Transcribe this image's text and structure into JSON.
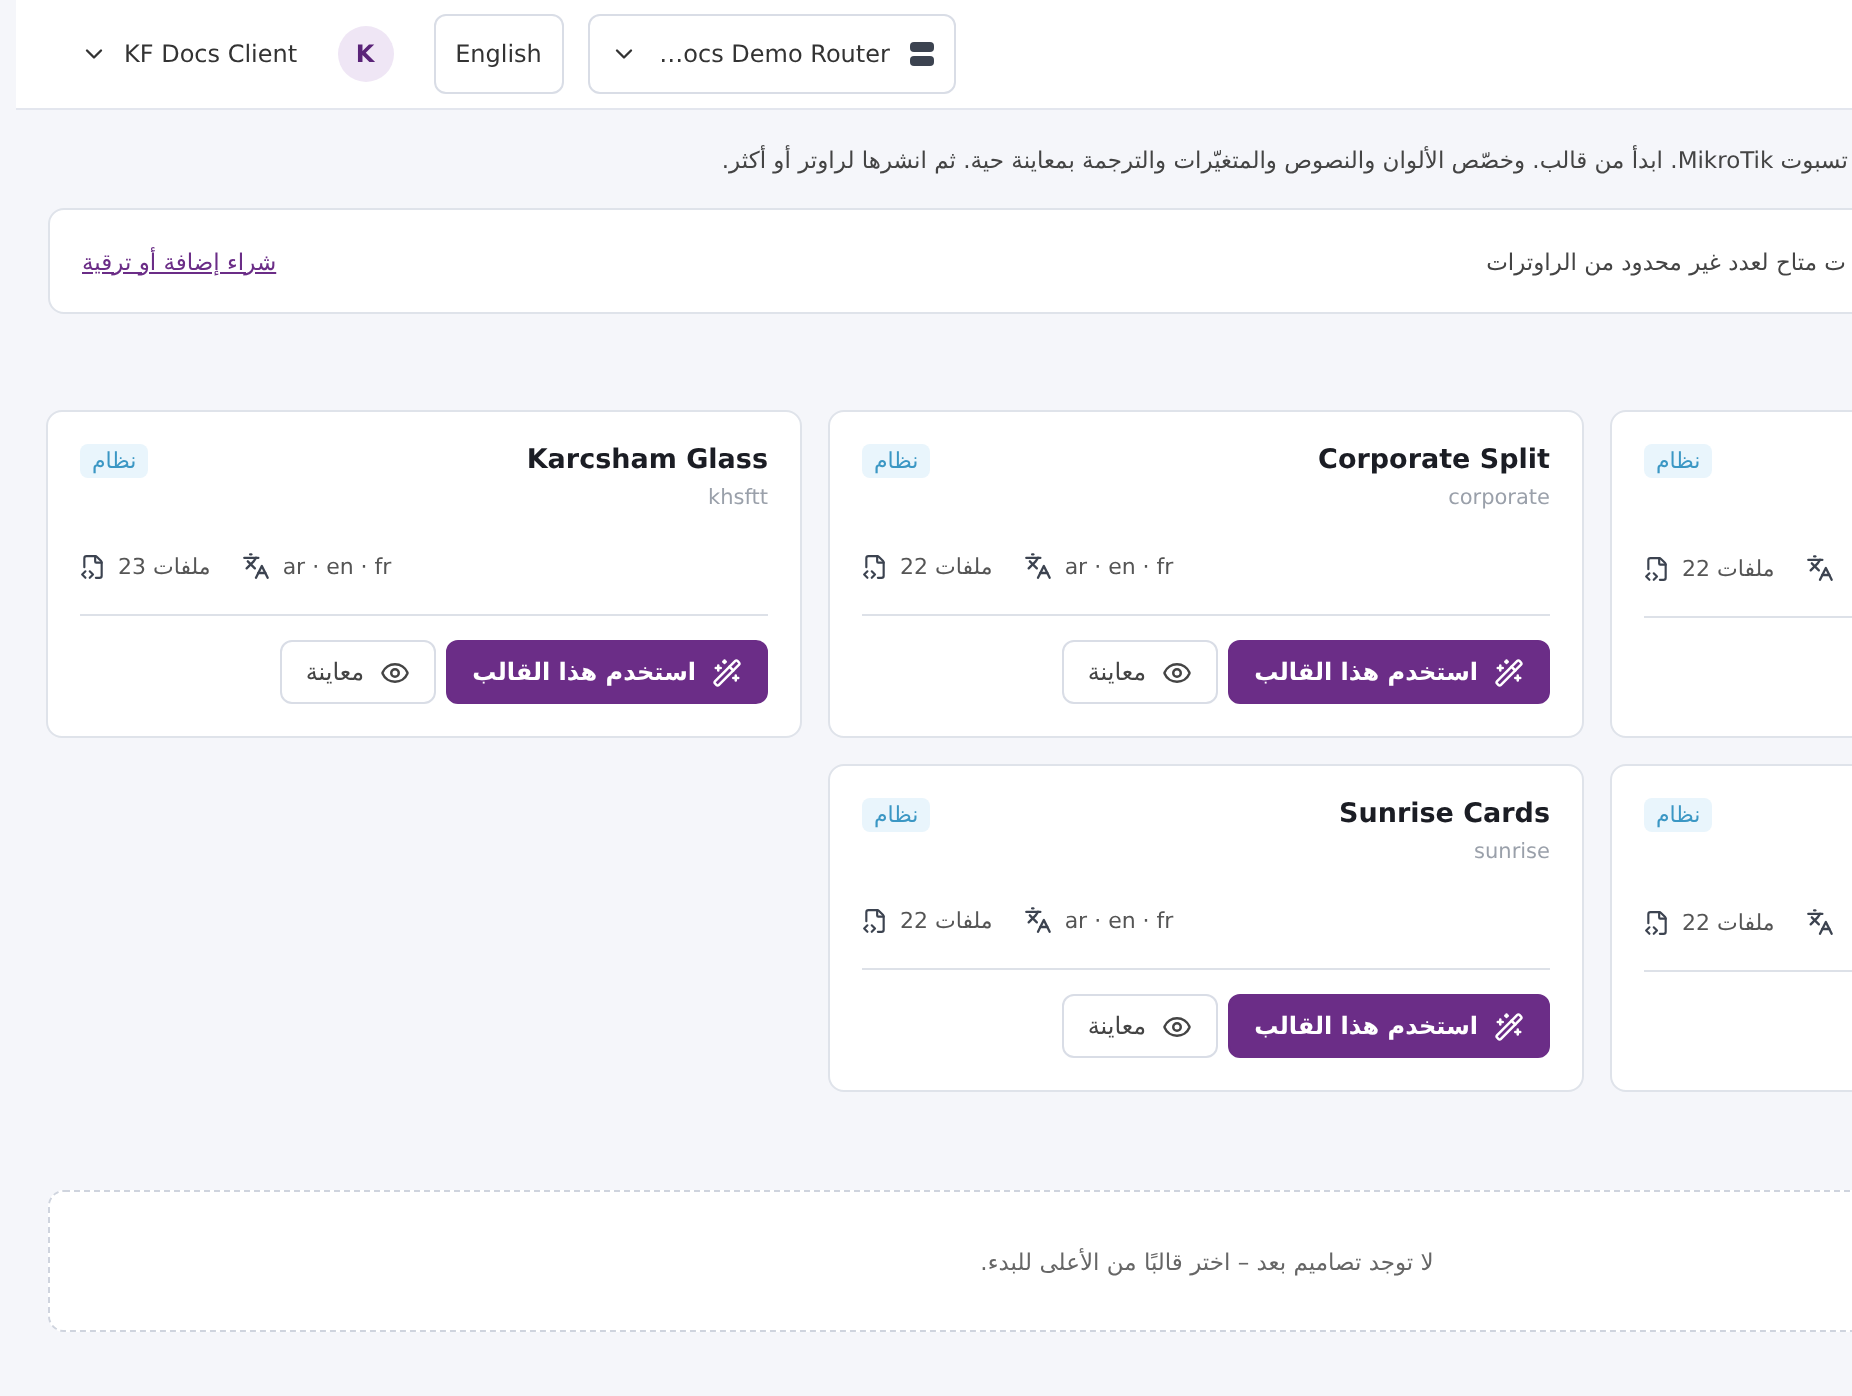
{
  "header": {
    "account": {
      "name": "KF Docs Client",
      "initial": "K"
    },
    "language": "English",
    "router": "…ocs Demo Router"
  },
  "intro": "تسبوت MikroTik. ابدأ من قالب. وخصّص الألوان والنصوص والمتغيّرات والترجمة بمعاينة حية. ثم انشرها لراوتر أو أكثر.",
  "banner": {
    "text": "ت متاح لعدد غير محدود من الراوترات",
    "link": "شراء إضافة أو ترقية"
  },
  "cards": [
    {
      "tag": "نظام",
      "files": "ملفات 22"
    },
    {
      "title": "Corporate Split",
      "slug": "corporate",
      "tag": "نظام",
      "files": "ملفات 22",
      "languages": "ar · en · fr",
      "actions": [
        {
          "kind": "primary",
          "label": "استخدم هذا القالب"
        },
        {
          "kind": "secondary",
          "label": "معاينة"
        }
      ]
    },
    {
      "title": "Karcsham Glass",
      "slug": "khsftt",
      "tag": "نظام",
      "files": "ملفات 23",
      "languages": "ar · en · fr",
      "actions": [
        {
          "kind": "primary",
          "label": "استخدم هذا القالب"
        },
        {
          "kind": "secondary",
          "label": "معاينة"
        }
      ]
    },
    {
      "tag": "نظام",
      "files": "ملفات 22"
    },
    {
      "title": "Sunrise Cards",
      "slug": "sunrise",
      "tag": "نظام",
      "files": "ملفات 22",
      "languages": "ar · en · fr",
      "actions": [
        {
          "kind": "primary",
          "label": "استخدم هذا القالب"
        },
        {
          "kind": "secondary",
          "label": "معاينة"
        }
      ]
    }
  ],
  "empty": "لا توجد تصاميم بعد – اختر قالبًا من الأعلى للبدء."
}
